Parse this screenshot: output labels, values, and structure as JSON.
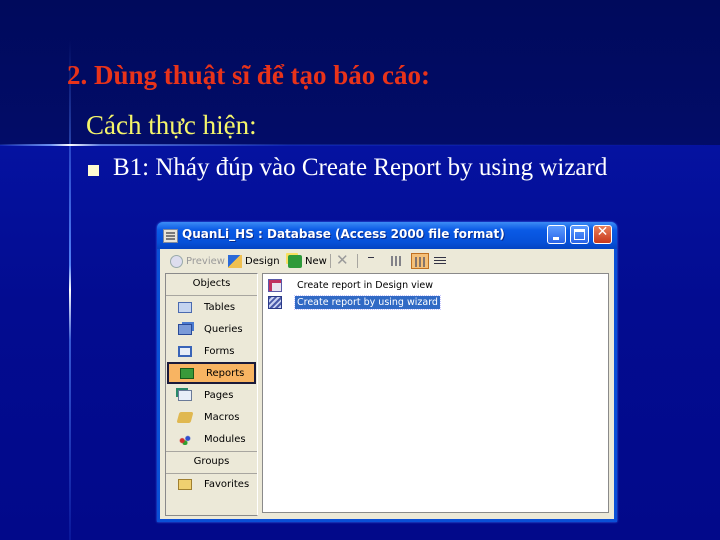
{
  "slide": {
    "title": "2. Dùng thuật sĩ để tạo báo cáo:",
    "subtitle": "Cách thực hiện:",
    "bullets": [
      {
        "icon": "square-bullet",
        "text": "B1: Nháy đúp vào Create Report by using wizard"
      }
    ]
  },
  "window": {
    "title": "QuanLi_HS : Database (Access 2000 file format)",
    "icon": "database-window-icon",
    "controls": {
      "minimize": "minimize",
      "maximize": "maximize",
      "close": "✕"
    },
    "toolbar": {
      "preview_label": "Preview",
      "design_label": "Design",
      "new_label": "New",
      "delete_icon": "✕",
      "view_modes": [
        "large-icons",
        "small-icons",
        "list",
        "details"
      ],
      "active_view": "list"
    },
    "objects_header": "Objects",
    "objects": [
      {
        "label": "Tables",
        "icon": "table-icon"
      },
      {
        "label": "Queries",
        "icon": "query-icon"
      },
      {
        "label": "Forms",
        "icon": "form-icon"
      },
      {
        "label": "Reports",
        "icon": "report-icon",
        "selected": true
      },
      {
        "label": "Pages",
        "icon": "page-icon"
      },
      {
        "label": "Macros",
        "icon": "macro-icon"
      },
      {
        "label": "Modules",
        "icon": "module-icon"
      }
    ],
    "groups_header": "Groups",
    "groups": [
      {
        "label": "Favorites",
        "icon": "favorites-folder-icon"
      }
    ],
    "list_items": [
      {
        "label": "Create report in Design view",
        "icon": "design-view-icon",
        "selected": false
      },
      {
        "label": "Create report by using wizard",
        "icon": "wizard-icon",
        "selected": true
      }
    ]
  },
  "colors": {
    "title": "#e8331a",
    "subtitle": "#f5f56a",
    "body_text": "#ffffff",
    "selection": "#316ac5",
    "selected_object": "#f8b462"
  }
}
